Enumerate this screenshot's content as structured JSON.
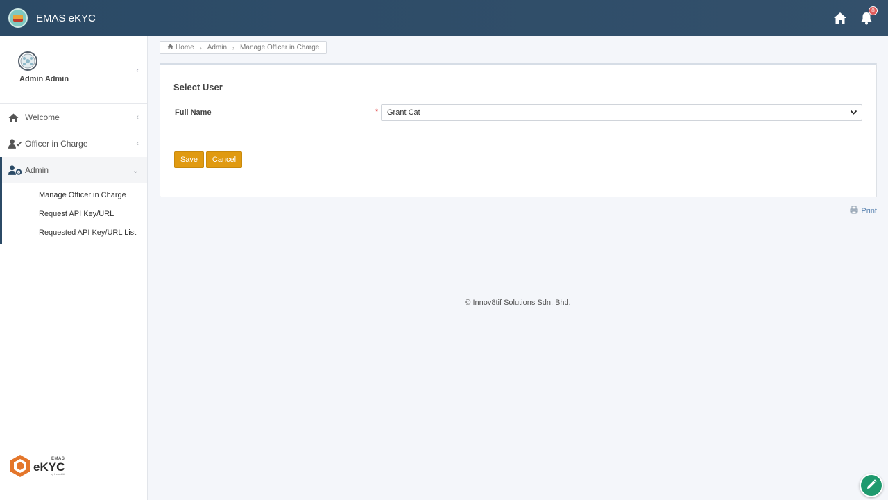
{
  "header": {
    "app_title": "EMAS eKYC",
    "notification_count": "0",
    "colors": {
      "bar": "#2b4a66",
      "badge": "#e05a5a"
    },
    "icons": [
      "app-logo-icon",
      "home-icon",
      "bell-icon"
    ]
  },
  "sidebar": {
    "user_name": "Admin Admin",
    "items": [
      {
        "label": "Welcome",
        "icon": "home-icon"
      },
      {
        "label": "Officer in Charge",
        "icon": "user-check-icon"
      },
      {
        "label": "Admin",
        "icon": "user-gear-icon"
      }
    ],
    "admin_subitems": [
      {
        "label": "Manage Officer in Charge"
      },
      {
        "label": "Request API Key/URL"
      },
      {
        "label": "Requested API Key/URL List"
      }
    ],
    "brand": {
      "small": "EMAS",
      "big": "eKYC",
      "by": "by Innov8tif"
    }
  },
  "breadcrumb": [
    "Home",
    "Admin",
    "Manage Officer in Charge"
  ],
  "panel": {
    "title": "Select User",
    "field_label": "Full Name",
    "required_mark": "*",
    "selected_value": "Grant Cat",
    "save_label": "Save",
    "cancel_label": "Cancel",
    "button_color": "#e09a11"
  },
  "print_label": "Print",
  "footer": "© Innov8tif Solutions Sdn. Bhd."
}
